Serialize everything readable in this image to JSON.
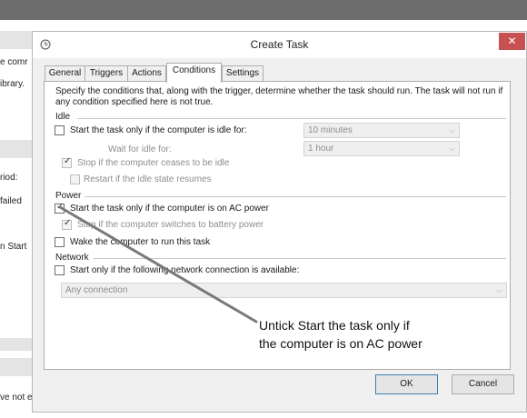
{
  "background": {
    "fragments": [
      "e comr",
      "ibrary.",
      "riod:",
      "failed",
      "n Start",
      "ve not e"
    ]
  },
  "dialog": {
    "title": "Create Task",
    "close_glyph": "✕",
    "tabs": [
      "General",
      "Triggers",
      "Actions",
      "Conditions",
      "Settings"
    ],
    "active_tab": "Conditions",
    "description": "Specify the conditions that, along with the trigger, determine whether the task should run.  The task will not run  if any condition specified here is not true.",
    "idle": {
      "heading": "Idle",
      "start_if_idle_label": "Start the task only if the computer is idle for:",
      "idle_for_value": "10 minutes",
      "wait_label": "Wait for idle for:",
      "wait_value": "1 hour",
      "stop_if_ceases_label": "Stop if the computer ceases to be idle",
      "restart_label": "Restart if the idle state resumes"
    },
    "power": {
      "heading": "Power",
      "ac_power_label": "Start the task only if the computer is on AC power",
      "battery_label": "Stop if the computer switches to battery power",
      "wake_label": "Wake the computer to run this task"
    },
    "network": {
      "heading": "Network",
      "network_label": "Start only if the following network connection is available:",
      "connection_value": "Any connection"
    },
    "buttons": {
      "ok": "OK",
      "cancel": "Cancel"
    }
  },
  "annotation": {
    "line1": "Untick Start the task only if",
    "line2": "the computer is on AC power"
  }
}
